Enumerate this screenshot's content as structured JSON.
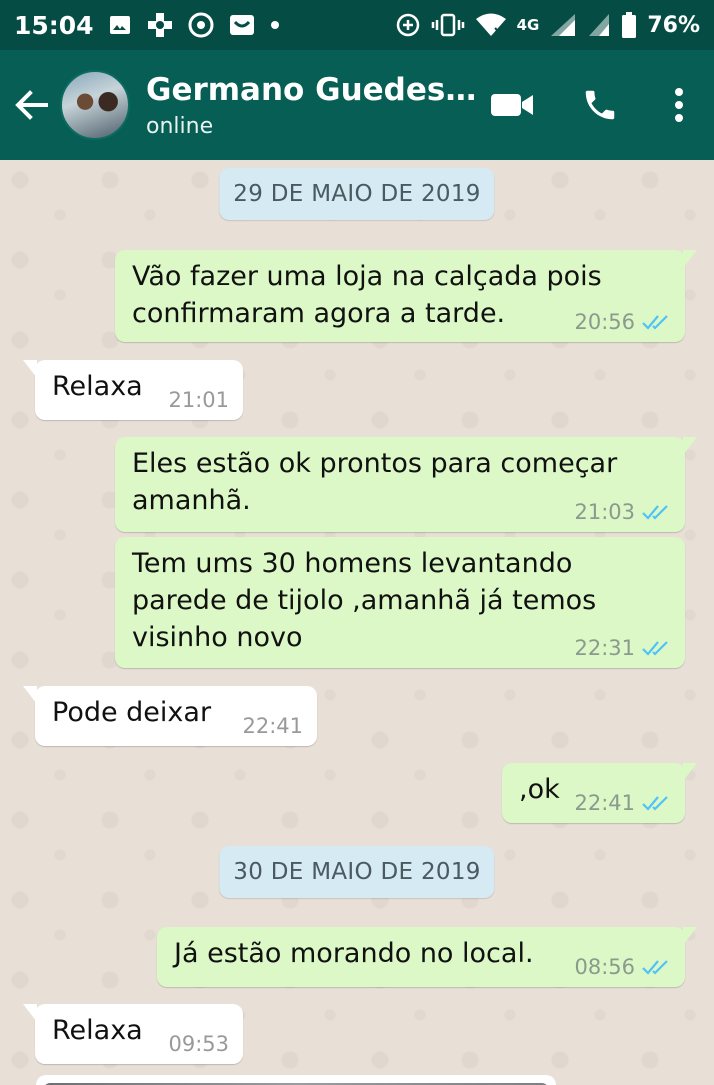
{
  "status_bar": {
    "time": "15:04",
    "network": "4G",
    "battery": "76%"
  },
  "header": {
    "contact_name": "Germano Guedes…",
    "contact_status": "online"
  },
  "colors": {
    "header": "#075e54",
    "status_bar": "#054d44",
    "outgoing_bubble": "#dcf8c6",
    "incoming_bubble": "#ffffff",
    "read_ticks": "#4fc3f7",
    "date_chip": "#d5eaf3"
  },
  "chat": {
    "date_1": "29 DE MAIO DE 2019",
    "date_2": "30 DE MAIO DE 2019",
    "messages": [
      {
        "direction": "out",
        "lines": [
          "Vão fazer uma loja na calçada pois",
          "confirmaram agora a tarde."
        ],
        "time": "20:56",
        "status": "read"
      },
      {
        "direction": "in",
        "lines": [
          "Relaxa"
        ],
        "time": "21:01"
      },
      {
        "direction": "out",
        "lines": [
          "Eles estão ok prontos para começar",
          "amanhã."
        ],
        "time": "21:03",
        "status": "read"
      },
      {
        "direction": "out",
        "lines": [
          "Tem ums 30 homens levantando",
          "parede de tijolo ,amanhã já temos",
          "visinho novo"
        ],
        "time": "22:31",
        "status": "read"
      },
      {
        "direction": "in",
        "lines": [
          "Pode deixar"
        ],
        "time": "22:41"
      },
      {
        "direction": "out",
        "lines": [
          ",ok"
        ],
        "time": "22:41",
        "status": "read"
      },
      {
        "direction": "out",
        "lines": [
          "Já estão morando no local."
        ],
        "time": "08:56",
        "status": "read"
      },
      {
        "direction": "in",
        "lines": [
          "Relaxa"
        ],
        "time": "09:53"
      }
    ]
  }
}
